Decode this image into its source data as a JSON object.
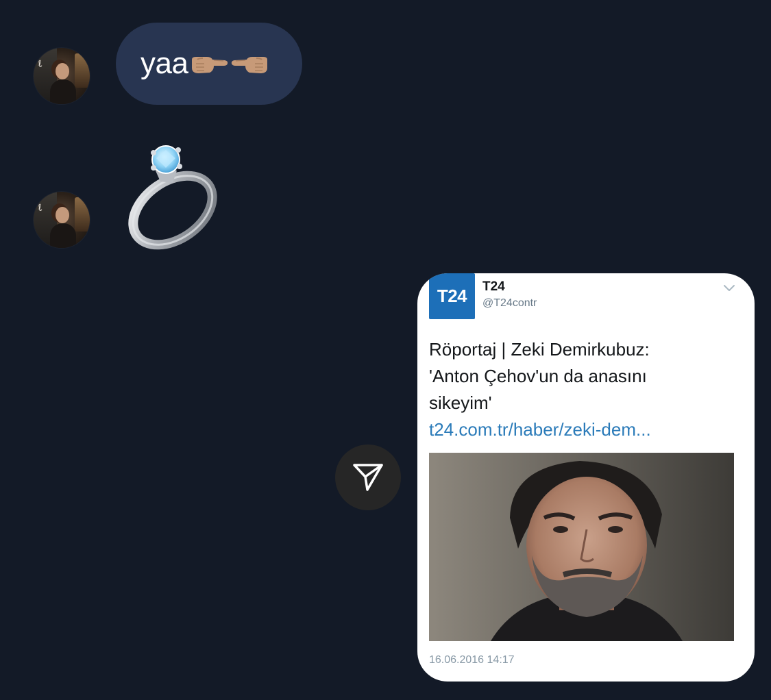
{
  "messages": [
    {
      "sender": "other",
      "text": "yaa",
      "emojis": [
        "backhand-index-pointing-right",
        "backhand-index-pointing-left"
      ]
    },
    {
      "sender": "other",
      "emoji": "ring"
    }
  ],
  "shared_post": {
    "logo_text": "T24",
    "name": "T24",
    "handle": "@T24contr",
    "text_lines": [
      "Röportaj | Zeki Demirkubuz:",
      "'Anton Çehov'un da anasını",
      "sikeyim'"
    ],
    "link": "t24.com.tr/haber/zeki-dem...",
    "timestamp": "16.06.2016 14:17",
    "photo": "portrait-of-man-with-grey-beard"
  },
  "icons": {
    "share": "paper-plane-icon",
    "menu": "chevron-down-icon"
  },
  "colors": {
    "background": "#131a27",
    "bubble": "#283551",
    "share_button": "#262626",
    "card": "#ffffff",
    "link": "#2b7bb9",
    "logo": "#1d6fb8"
  }
}
